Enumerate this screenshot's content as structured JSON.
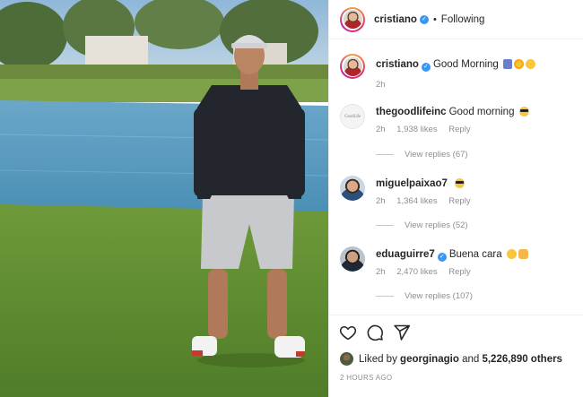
{
  "header": {
    "username": "cristiano",
    "separator": "•",
    "follow_status": "Following"
  },
  "comments": [
    {
      "username": "cristiano",
      "text": "Good Morning",
      "emojis": [
        "person-fencing",
        "sun",
        "smiling-face"
      ],
      "time": "2h",
      "likes": "",
      "reply": "",
      "view_replies": ""
    },
    {
      "username": "thegoodlifeinc",
      "text": "Good morning",
      "emojis": [
        "sunglasses-face"
      ],
      "time": "2h",
      "likes": "1,938 likes",
      "reply": "Reply",
      "view_replies": "View replies (67)"
    },
    {
      "username": "miguelpaixao7",
      "text": "",
      "emojis": [
        "sunglasses-face"
      ],
      "time": "2h",
      "likes": "1,364 likes",
      "reply": "Reply",
      "view_replies": "View replies (52)"
    },
    {
      "username": "eduaguirre7",
      "text": "Buena cara",
      "emojis": [
        "grinning-face",
        "raising-hands"
      ],
      "time": "2h",
      "likes": "2,470 likes",
      "reply": "Reply",
      "view_replies": "View replies (107)"
    }
  ],
  "likes_line": {
    "prefix": "Liked by",
    "user": "georginagio",
    "middle": "and",
    "count": "5,226,890 others"
  },
  "post_time": "2 HOURS AGO",
  "colors": {
    "verified": "#3897f0",
    "muted": "#8e8e8e",
    "text": "#262626"
  },
  "icons": [
    "heart-icon",
    "comment-icon",
    "share-icon"
  ]
}
